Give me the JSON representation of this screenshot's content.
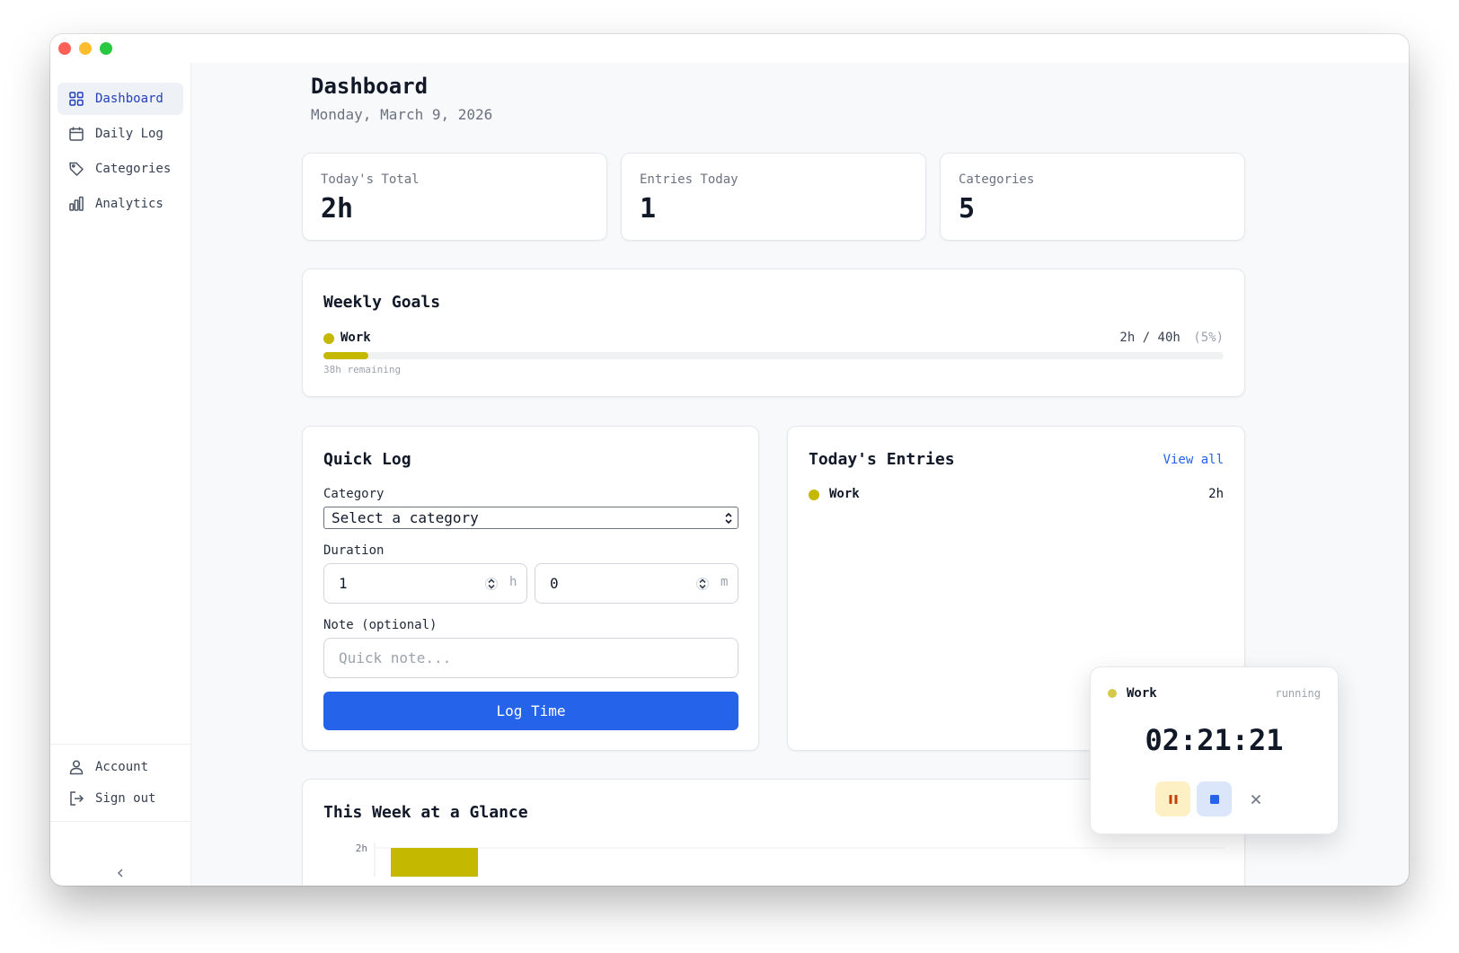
{
  "sidebar": {
    "items": [
      {
        "label": "Dashboard",
        "icon": "grid-icon",
        "active": true
      },
      {
        "label": "Daily Log",
        "icon": "calendar-icon"
      },
      {
        "label": "Categories",
        "icon": "tag-icon"
      },
      {
        "label": "Analytics",
        "icon": "bar-chart-icon"
      }
    ],
    "bottom": [
      {
        "label": "Account",
        "icon": "user-icon"
      },
      {
        "label": "Sign out",
        "icon": "sign-out-icon"
      }
    ],
    "collapse_icon": "chevron-left-icon"
  },
  "header": {
    "title": "Dashboard",
    "date": "Monday, March 9, 2026"
  },
  "stats": [
    {
      "label": "Today's Total",
      "value": "2h"
    },
    {
      "label": "Entries Today",
      "value": "1"
    },
    {
      "label": "Categories",
      "value": "5"
    }
  ],
  "weekly_goals": {
    "title": "Weekly Goals",
    "goal": {
      "name": "Work",
      "color": "#c4b800",
      "progress_text": "2h / 40h",
      "percent_text": "(5%)",
      "progress_fraction": 0.05,
      "remaining": "38h remaining"
    }
  },
  "quick_log": {
    "title": "Quick Log",
    "category_label": "Category",
    "category_value": "Select a category",
    "duration_label": "Duration",
    "hours_value": "1",
    "hours_unit": "h",
    "minutes_value": "0",
    "minutes_unit": "m",
    "note_label": "Note (optional)",
    "note_placeholder": "Quick note...",
    "submit_label": "Log Time"
  },
  "todays_entries": {
    "title": "Today's Entries",
    "view_all": "View all",
    "entries": [
      {
        "name": "Work",
        "color": "#c4b800",
        "duration": "2h"
      }
    ]
  },
  "week_glance": {
    "title": "This Week at a Glance",
    "chart_data": {
      "type": "bar",
      "ytick_labels": [
        "2h"
      ],
      "color": "#c4b800",
      "values": [
        2
      ]
    }
  },
  "timer": {
    "category": "Work",
    "color": "#d4c94a",
    "status": "running",
    "time": "02:21:21"
  },
  "colors": {
    "accent": "#2563eb",
    "active_nav": "#2540b8",
    "work": "#c4b800"
  }
}
